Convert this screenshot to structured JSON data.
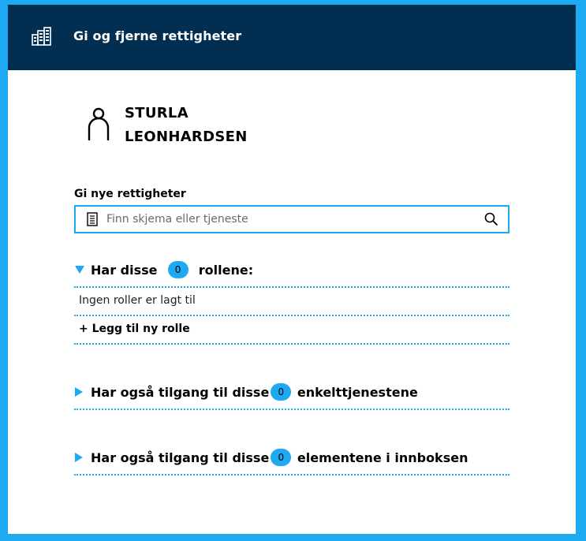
{
  "header": {
    "title": "Gi og fjerne rettigheter",
    "logo_icon": "building-icon"
  },
  "user": {
    "name": "STURLA LEONHARDSEN",
    "avatar_icon": "person-icon"
  },
  "grant": {
    "label": "Gi nye rettigheter",
    "search_placeholder": "Finn skjema eller tjeneste",
    "search_value": ""
  },
  "roles": {
    "prefix": "Har disse",
    "count": "0",
    "suffix": "rollene:",
    "expanded": true,
    "empty_text": "Ingen roller er lagt til",
    "add_label": "+ Legg til ny rolle"
  },
  "services": {
    "prefix": "Har også tilgang til disse",
    "count": "0",
    "suffix": "enkelttjenestene",
    "expanded": false
  },
  "inbox": {
    "prefix": "Har også tilgang til disse",
    "count": "0",
    "suffix": "elementene i innboksen",
    "expanded": false
  },
  "colors": {
    "accent": "#1eaaf1",
    "header_bg": "#022f51"
  }
}
